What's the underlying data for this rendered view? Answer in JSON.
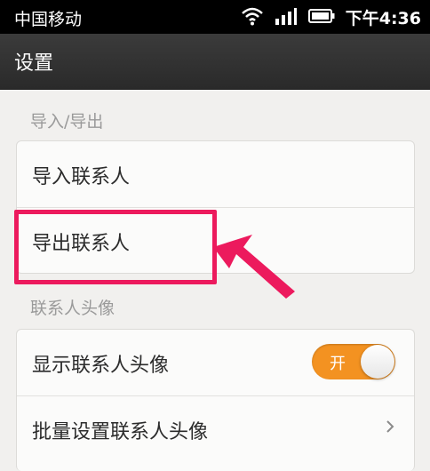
{
  "status_bar": {
    "carrier": "中国移动",
    "time": "下午4:36",
    "icons": [
      "wifi-icon",
      "signal-icon",
      "battery-icon"
    ]
  },
  "title_bar": {
    "title": "设置"
  },
  "sections": {
    "import_export": {
      "header": "导入/导出",
      "items": [
        {
          "label": "导入联系人"
        },
        {
          "label": "导出联系人"
        }
      ]
    },
    "contact_avatar": {
      "header": "联系人头像",
      "items": [
        {
          "label": "显示联系人头像",
          "toggle_label": "开",
          "toggle_on": true
        },
        {
          "label": "批量设置联系人头像"
        }
      ]
    }
  },
  "annotation": {
    "highlight_color": "#ec1a5d"
  },
  "colors": {
    "toggle_on": "#f39221",
    "section_header": "#9a9a9a"
  }
}
